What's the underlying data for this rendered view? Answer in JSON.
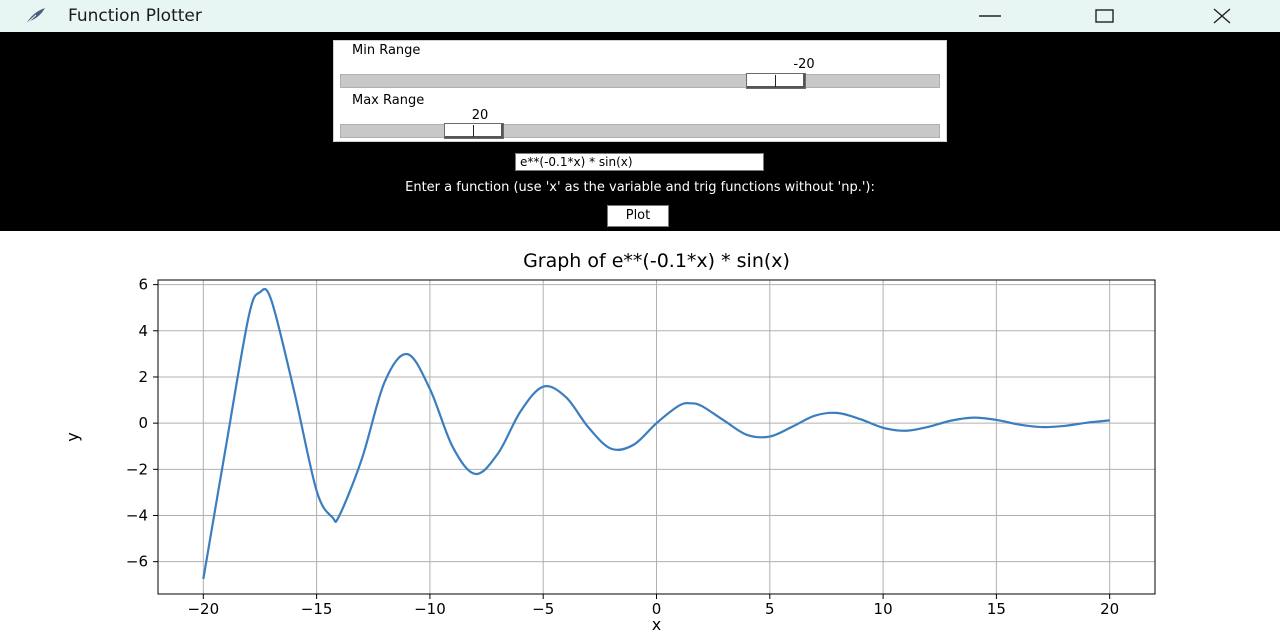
{
  "window": {
    "title": "Function Plotter",
    "icon": "feather-icon",
    "buttons": [
      "minimize-icon",
      "maximize-icon",
      "close-icon"
    ]
  },
  "controls": {
    "min_range": {
      "label": "Min Range",
      "value": "-20",
      "slider_fraction": 0.75
    },
    "max_range": {
      "label": "Max Range",
      "value": "20",
      "slider_fraction": 0.19
    },
    "function_input": {
      "value": "e**(-0.1*x) * sin(x)"
    },
    "hint": "Enter a function (use 'x' as the variable and trig functions without 'np.'):",
    "plot_label": "Plot"
  },
  "colors": {
    "line": "#3a7ebf",
    "controls_bg": "#000000",
    "titlebar_bg": "#e8f6f3"
  },
  "chart_data": {
    "type": "line",
    "title": "Graph of e**(-0.1*x) * sin(x)",
    "xlabel": "x",
    "ylabel": "y",
    "xlim": [
      -22,
      22
    ],
    "ylim": [
      -7.4,
      6.2
    ],
    "xticks": [
      -20,
      -15,
      -10,
      -5,
      0,
      5,
      10,
      15,
      20
    ],
    "xtick_labels": [
      "−20",
      "−15",
      "−10",
      "−5",
      "0",
      "5",
      "10",
      "15",
      "20"
    ],
    "yticks": [
      -6,
      -4,
      -2,
      0,
      2,
      4,
      6
    ],
    "ytick_labels": [
      "−6",
      "−4",
      "−2",
      "0",
      "2",
      "4",
      "6"
    ],
    "grid": true,
    "series": [
      {
        "function": "e**(-0.1*x) * sin(x)",
        "x_range": [
          -20,
          20
        ],
        "x": [
          -20,
          -19,
          -18,
          -17.5,
          -17,
          -16,
          -15,
          -14.3,
          -14,
          -13,
          -12,
          -11,
          -10,
          -9,
          -8,
          -7,
          -6,
          -5,
          -4,
          -3,
          -2,
          -1,
          0,
          1,
          1.5,
          2,
          3,
          4,
          5,
          6,
          7,
          8,
          9,
          10,
          11,
          12,
          13,
          14,
          15,
          16,
          17,
          18,
          19,
          20
        ],
        "y": [
          -6.75,
          -1.0,
          4.61,
          5.67,
          5.33,
          1.42,
          -2.93,
          -4.08,
          -4.01,
          -1.54,
          1.78,
          2.99,
          1.48,
          -1.02,
          -2.2,
          -1.32,
          0.51,
          1.58,
          1.13,
          -0.19,
          -1.11,
          -0.93,
          0,
          0.76,
          0.86,
          0.74,
          0.1,
          -0.51,
          -0.58,
          -0.15,
          0.33,
          0.44,
          0.17,
          -0.2,
          -0.33,
          -0.16,
          0.11,
          0.24,
          0.14,
          -0.06,
          -0.17,
          -0.12,
          0.02,
          0.12
        ]
      }
    ]
  }
}
